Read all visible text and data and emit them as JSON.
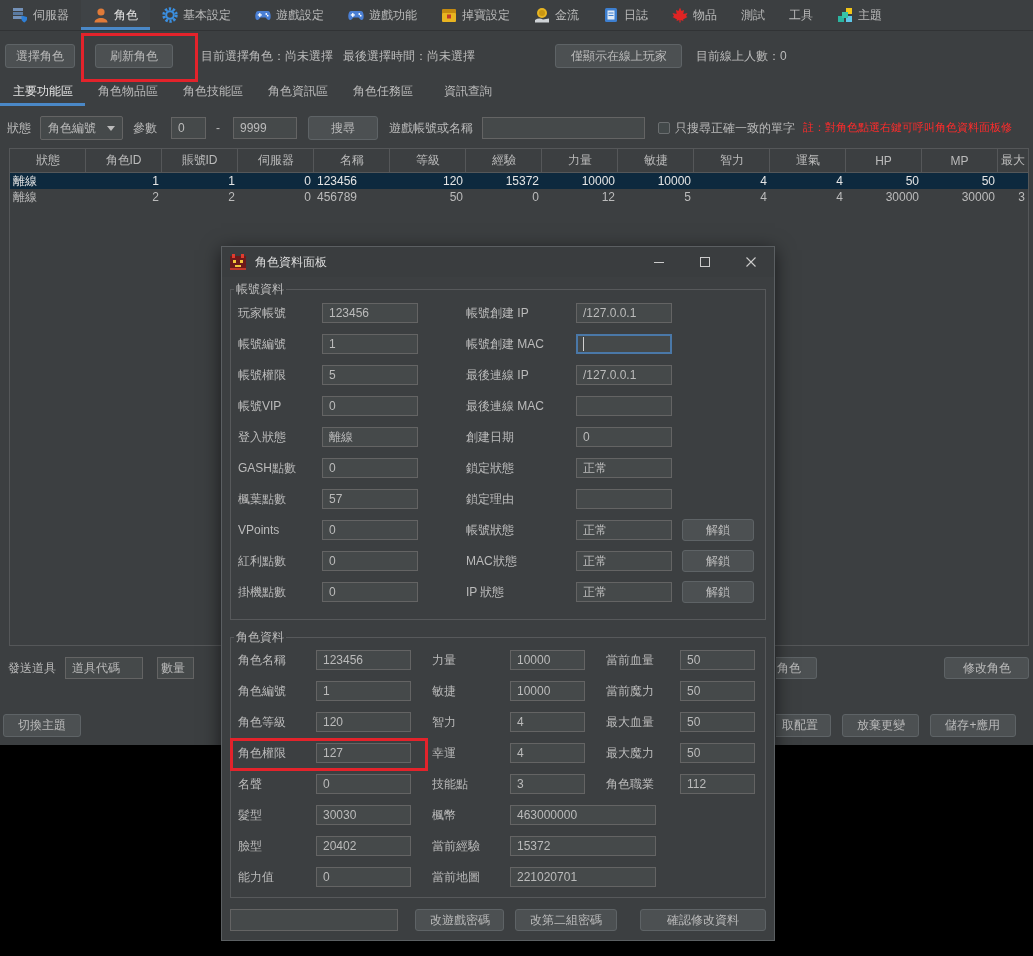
{
  "menu_tabs": [
    {
      "label": "伺服器",
      "selected": false
    },
    {
      "label": "角色",
      "selected": true
    },
    {
      "label": "基本設定",
      "selected": false
    },
    {
      "label": "遊戲設定",
      "selected": false
    },
    {
      "label": "遊戲功能",
      "selected": false
    },
    {
      "label": "掉寶設定",
      "selected": false
    },
    {
      "label": "金流",
      "selected": false
    },
    {
      "label": "日誌",
      "selected": false
    },
    {
      "label": "物品",
      "selected": false
    },
    {
      "label": "測試",
      "selected": false
    },
    {
      "label": "工具",
      "selected": false
    },
    {
      "label": "主題",
      "selected": false
    }
  ],
  "toolbar": {
    "buttons": [
      {
        "label": "選擇角色",
        "highlighted": false
      },
      {
        "label": "刷新角色",
        "highlighted": true
      }
    ],
    "selected_character": "目前選擇角色：尚未選擇",
    "last_selected_time": "最後選擇時間：尚未選擇",
    "online_filter_button": "僅顯示在線上玩家",
    "online_count": "目前線上人數：0"
  },
  "sub_tabs": [
    {
      "label": "主要功能區",
      "selected": true
    },
    {
      "label": "角色物品區",
      "selected": false
    },
    {
      "label": "角色技能區",
      "selected": false
    },
    {
      "label": "角色資訊區",
      "selected": false
    },
    {
      "label": "角色任務區",
      "selected": false
    },
    {
      "label": "資訊查詢",
      "selected": false
    }
  ],
  "filter": {
    "status_label": "狀態",
    "status_select": "角色編號",
    "param_label": "參數",
    "param_from": "0",
    "range_separator": "-",
    "param_to": "9999",
    "search_button": "搜尋",
    "account_label": "遊戲帳號或名稱",
    "exact_match": {
      "label": "只搜尋正確一致的單字",
      "checked": false
    },
    "note": "註：對角色點選右鍵可呼叫角色資料面板修"
  },
  "table": {
    "columns": [
      "狀態",
      "角色ID",
      "賬號ID",
      "伺服器",
      "名稱",
      "等級",
      "經驗",
      "力量",
      "敏捷",
      "智力",
      "運氣",
      "HP",
      "MP",
      "最大"
    ],
    "rows": [
      {
        "selected": true,
        "cells": [
          "離線",
          "1",
          "1",
          "0",
          "123456",
          "120",
          "15372",
          "10000",
          "10000",
          "4",
          "4",
          "50",
          "50"
        ]
      },
      {
        "selected": false,
        "cells": [
          "離線",
          "2",
          "2",
          "0",
          "456789",
          "50",
          "0",
          "12",
          "5",
          "4",
          "4",
          "30000",
          "30000",
          "3"
        ]
      }
    ]
  },
  "send_item": {
    "label": "發送道具",
    "item_code_field": {
      "placeholder": "道具代碼"
    },
    "quantity_field": {
      "placeholder": "數量"
    }
  },
  "role_buttons": [
    "角色",
    "修改角色"
  ],
  "theme_button": "切換主題",
  "config_buttons": [
    "取配置",
    "放棄更變",
    "儲存+應用"
  ],
  "dialog": {
    "title": "角色資料面板",
    "account": {
      "title": "帳號資料",
      "left": [
        {
          "label": "玩家帳號",
          "value": "123456"
        },
        {
          "label": "帳號編號",
          "value": "1"
        },
        {
          "label": "帳號權限",
          "value": "5"
        },
        {
          "label": "帳號VIP",
          "value": "0"
        },
        {
          "label": "登入狀態",
          "value": "離線"
        },
        {
          "label": "GASH點數",
          "value": "0"
        },
        {
          "label": "楓葉點數",
          "value": "57"
        },
        {
          "label": "VPoints",
          "value": "0"
        },
        {
          "label": "紅利點數",
          "value": "0"
        },
        {
          "label": "掛機點數",
          "value": "0"
        }
      ],
      "right": [
        {
          "label": "帳號創建 IP",
          "value": "/127.0.0.1",
          "focused": false
        },
        {
          "label": "帳號創建 MAC",
          "focused": true
        },
        {
          "label": "最後連線 IP",
          "value": "/127.0.0.1",
          "focused": false
        },
        {
          "label": "最後連線 MAC",
          "focused": false
        },
        {
          "label": "創建日期",
          "value": "0",
          "focused": false
        },
        {
          "label": "鎖定狀態",
          "value": "正常",
          "focused": false
        },
        {
          "label": "鎖定理由",
          "focused": false
        },
        {
          "label": "帳號狀態",
          "value": "正常",
          "focused": false,
          "button": "解鎖"
        },
        {
          "label": "MAC狀態",
          "value": "正常",
          "focused": false,
          "button": "解鎖"
        },
        {
          "label": "IP 狀態",
          "value": "正常",
          "focused": false,
          "button": "解鎖"
        }
      ]
    },
    "character": {
      "title": "角色資料",
      "rows": [
        [
          {
            "label": "角色名稱",
            "value": "123456",
            "highlighted": false
          },
          {
            "label": "力量",
            "value": "10000",
            "highlighted": false
          },
          {
            "label": "當前血量",
            "value": "50",
            "highlighted": false
          }
        ],
        [
          {
            "label": "角色編號",
            "value": "1",
            "highlighted": false
          },
          {
            "label": "敏捷",
            "value": "10000",
            "highlighted": false
          },
          {
            "label": "當前魔力",
            "value": "50",
            "highlighted": false
          }
        ],
        [
          {
            "label": "角色等級",
            "value": "120",
            "highlighted": false
          },
          {
            "label": "智力",
            "value": "4",
            "highlighted": false
          },
          {
            "label": "最大血量",
            "value": "50",
            "highlighted": false
          }
        ],
        [
          {
            "label": "角色權限",
            "value": "127",
            "highlighted": true
          },
          {
            "label": "幸運",
            "value": "4",
            "highlighted": false
          },
          {
            "label": "最大魔力",
            "value": "50",
            "highlighted": false
          }
        ],
        [
          {
            "label": "名聲",
            "value": "0",
            "highlighted": false
          },
          {
            "label": "技能點",
            "value": "3",
            "highlighted": false
          },
          {
            "label": "角色職業",
            "value": "112",
            "highlighted": false
          }
        ],
        [
          {
            "label": "髮型",
            "value": "30030",
            "highlighted": false
          },
          {
            "label": "楓幣",
            "value": "463000000",
            "highlighted": false
          }
        ],
        [
          {
            "label": "臉型",
            "value": "20402",
            "highlighted": false
          },
          {
            "label": "當前經驗",
            "value": "15372",
            "highlighted": false
          }
        ],
        [
          {
            "label": "能力值",
            "value": "0",
            "highlighted": false
          },
          {
            "label": "當前地圖",
            "value": "221020701",
            "highlighted": false
          }
        ]
      ]
    },
    "buttons": [
      "改遊戲密碼",
      "改第二組密碼",
      "確認修改資料"
    ]
  }
}
